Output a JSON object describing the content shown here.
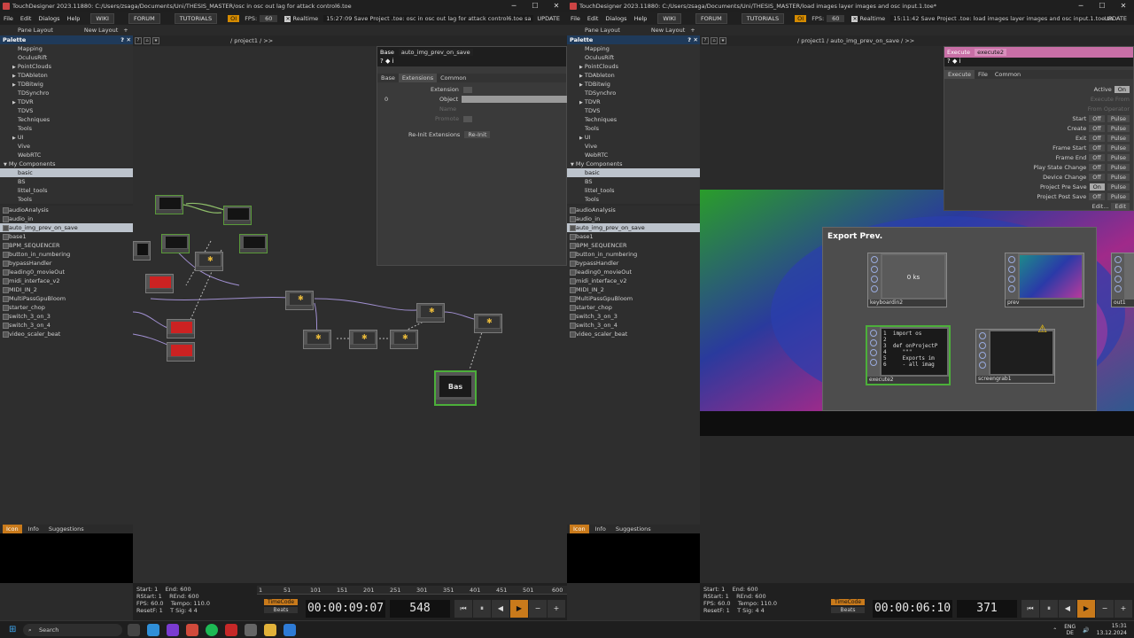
{
  "left": {
    "titlebar": "TouchDesigner 2023.11880: C:/Users/zsaga/Documents/Uni/THESIS_MASTER/osc in osc out lag for attack control6.toe",
    "status": "15:27:09 Save Project .toe: osc in osc out lag for attack control6.toe sa",
    "fps": "60",
    "network_path": "/ project1 / >>",
    "param": {
      "type_label": "Base",
      "name": "auto_img_prev_on_save",
      "tabs": [
        "Base",
        "Extensions",
        "Common"
      ],
      "extension_label": "Extension",
      "object_index": "0",
      "object_label": "Object",
      "name_label": "Name",
      "promote_label": "Promote",
      "reinit_label": "Re-Init Extensions",
      "reinit_button": "Re-Init"
    },
    "selected_node_label": "Bas",
    "timeline": {
      "start": "1",
      "end": "600",
      "rstart": "1",
      "rend": "600",
      "fps": "60.0",
      "tempo": "110.0",
      "resetf": "1",
      "tsig_a": "4",
      "tsig_b": "4",
      "time": "00:00:09:07",
      "frame": "548"
    }
  },
  "right": {
    "titlebar": "TouchDesigner 2023.11880: C:/Users/zsaga/Documents/Uni/THESIS_MASTER/load images layer images and osc input.1.toe*",
    "status": "15:11:42 Save Project .toe: load images layer images and osc input.1.toe sa",
    "fps": "60",
    "network_path": "/ project1 / auto_img_prev_on_save / >>",
    "param": {
      "type_label": "Execute",
      "name": "execute2",
      "tabs": [
        "Execute",
        "File",
        "Common"
      ],
      "rows": [
        {
          "label": "Active",
          "value": "On",
          "on": true
        },
        {
          "label": "Execute From",
          "value": "",
          "dim": true
        },
        {
          "label": "From Operator",
          "value": "",
          "dim": true
        },
        {
          "label": "Start",
          "value": "Off",
          "pulse": "Pulse"
        },
        {
          "label": "Create",
          "value": "Off",
          "pulse": "Pulse"
        },
        {
          "label": "Exit",
          "value": "Off",
          "pulse": "Pulse"
        },
        {
          "label": "Frame Start",
          "value": "Off",
          "pulse": "Pulse"
        },
        {
          "label": "Frame End",
          "value": "Off",
          "pulse": "Pulse"
        },
        {
          "label": "Play State Change",
          "value": "Off",
          "pulse": "Pulse"
        },
        {
          "label": "Device Change",
          "value": "Off",
          "pulse": "Pulse"
        },
        {
          "label": "Project Pre Save",
          "value": "On",
          "on": true,
          "pulse": "Pulse"
        },
        {
          "label": "Project Post Save",
          "value": "Off",
          "pulse": "Pulse"
        },
        {
          "label": "Edit...",
          "value": "Edit"
        }
      ]
    },
    "export_title": "Export Prev.",
    "nodes": [
      {
        "name": "keyboardin2",
        "text": "0 ks"
      },
      {
        "name": "prev",
        "text": ""
      },
      {
        "name": "out1",
        "text": ""
      },
      {
        "name": "execute2",
        "text": "1  import os\n2\n3  def onProjectP\n4     \"\"\"\n5     Exports im\n6     - all imag"
      },
      {
        "name": "screengrab1",
        "text": ""
      }
    ],
    "timeline": {
      "start": "1",
      "end": "600",
      "rstart": "1",
      "rend": "600",
      "fps": "60.0",
      "tempo": "110.0",
      "resetf": "1",
      "tsig_a": "4",
      "tsig_b": "4",
      "time": "00:00:06:10",
      "frame": "371"
    }
  },
  "menu": [
    "File",
    "Edit",
    "Dialogs",
    "Help"
  ],
  "menu_buttons": [
    "WIKI",
    "FORUM",
    "TUTORIALS"
  ],
  "oi_label": "OI",
  "fps_label": "FPS:",
  "realtime_label": "Realtime",
  "update_label": "UPDATE",
  "pane_layout": "Pane Layout",
  "new_layout": "New Layout",
  "palette_title": "Palette",
  "palette_items": [
    "Mapping",
    "OculusRift",
    "PointClouds",
    "TDAbleton",
    "TDBitwig",
    "TDSynchro",
    "TDVR",
    "TDVS",
    "Techniques",
    "Tools",
    "UI",
    "Vive",
    "WebRTC",
    "My Components",
    "basic",
    "BS",
    "littel_tools",
    "Tools"
  ],
  "component_items": [
    "audioAnalysis",
    "audio_in",
    "auto_img_prev_on_save",
    "base1",
    "BPM_SEQUENCER",
    "button_in_numbering",
    "bypassHandler",
    "leading0_movieOut",
    "midi_interface_v2",
    "MIDI_IN_2",
    "MultiPassGpuBloom",
    "starter_chop",
    "switch_3_on_3",
    "switch_3_on_4",
    "video_scaler_beat"
  ],
  "bottom_tabs": [
    "Icon",
    "Info",
    "Suggestions"
  ],
  "timeline_labels": {
    "start": "Start:",
    "end": "End:",
    "rstart": "RStart:",
    "rend": "REnd:",
    "fps": "FPS:",
    "tempo": "Tempo:",
    "resetf": "ResetF:",
    "tsig": "T Sig:",
    "timecode": "TimeCode",
    "beats": "Beats"
  },
  "ruler_ticks": [
    "1",
    "51",
    "101",
    "151",
    "201",
    "251",
    "301",
    "351",
    "401",
    "451",
    "501",
    "600"
  ],
  "taskbar": {
    "search": "Search",
    "lang": "ENG\nDE",
    "time": "15:31",
    "date": "13.12.2024"
  }
}
